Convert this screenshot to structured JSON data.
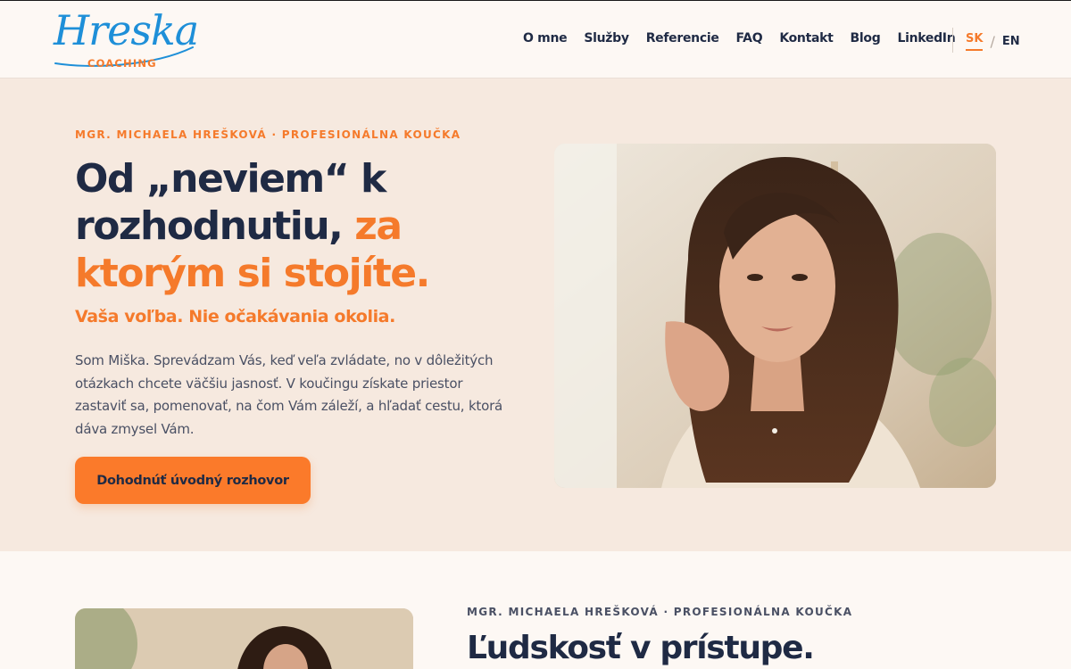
{
  "header": {
    "logo": {
      "script": "Hreska",
      "sub": "COACHING"
    },
    "nav": [
      "O mne",
      "Služby",
      "Referencie",
      "FAQ",
      "Kontakt",
      "Blog",
      "LinkedIn"
    ],
    "lang": {
      "active": "SK",
      "separator": "/",
      "other": "EN"
    }
  },
  "hero": {
    "eyebrow": "MGR. MICHAELA HREŠKOVÁ · PROFESIONÁLNA KOUČKA",
    "headline_part1": "Od „neviem“ k rozhodnutiu, ",
    "headline_accent": "za ktorým si stojíte.",
    "subhead": "Vaša voľba. Nie očakávania okolia.",
    "intro": "Som Miška. Sprevádzam Vás, keď veľa zvládate, no v dôležitých otázkach chcete väčšiu jasnosť. V koučingu získate priestor zastaviť sa, pomenovať, na čom Vám záleží, a hľadať cestu, ktorá dáva zmysel Vám.",
    "cta": "Dohodnúť úvodný rozhovor"
  },
  "section2": {
    "eyebrow": "MGR. MICHAELA HREŠKOVÁ · PROFESIONÁLNA KOUČKA",
    "title": "Ľudskosť v prístupe."
  },
  "colors": {
    "accent": "#f57a2b",
    "navy": "#1f2a44",
    "logo_blue": "#1e8fd8",
    "hero_bg": "#f6e9df",
    "page_bg": "#fdf8f4"
  }
}
